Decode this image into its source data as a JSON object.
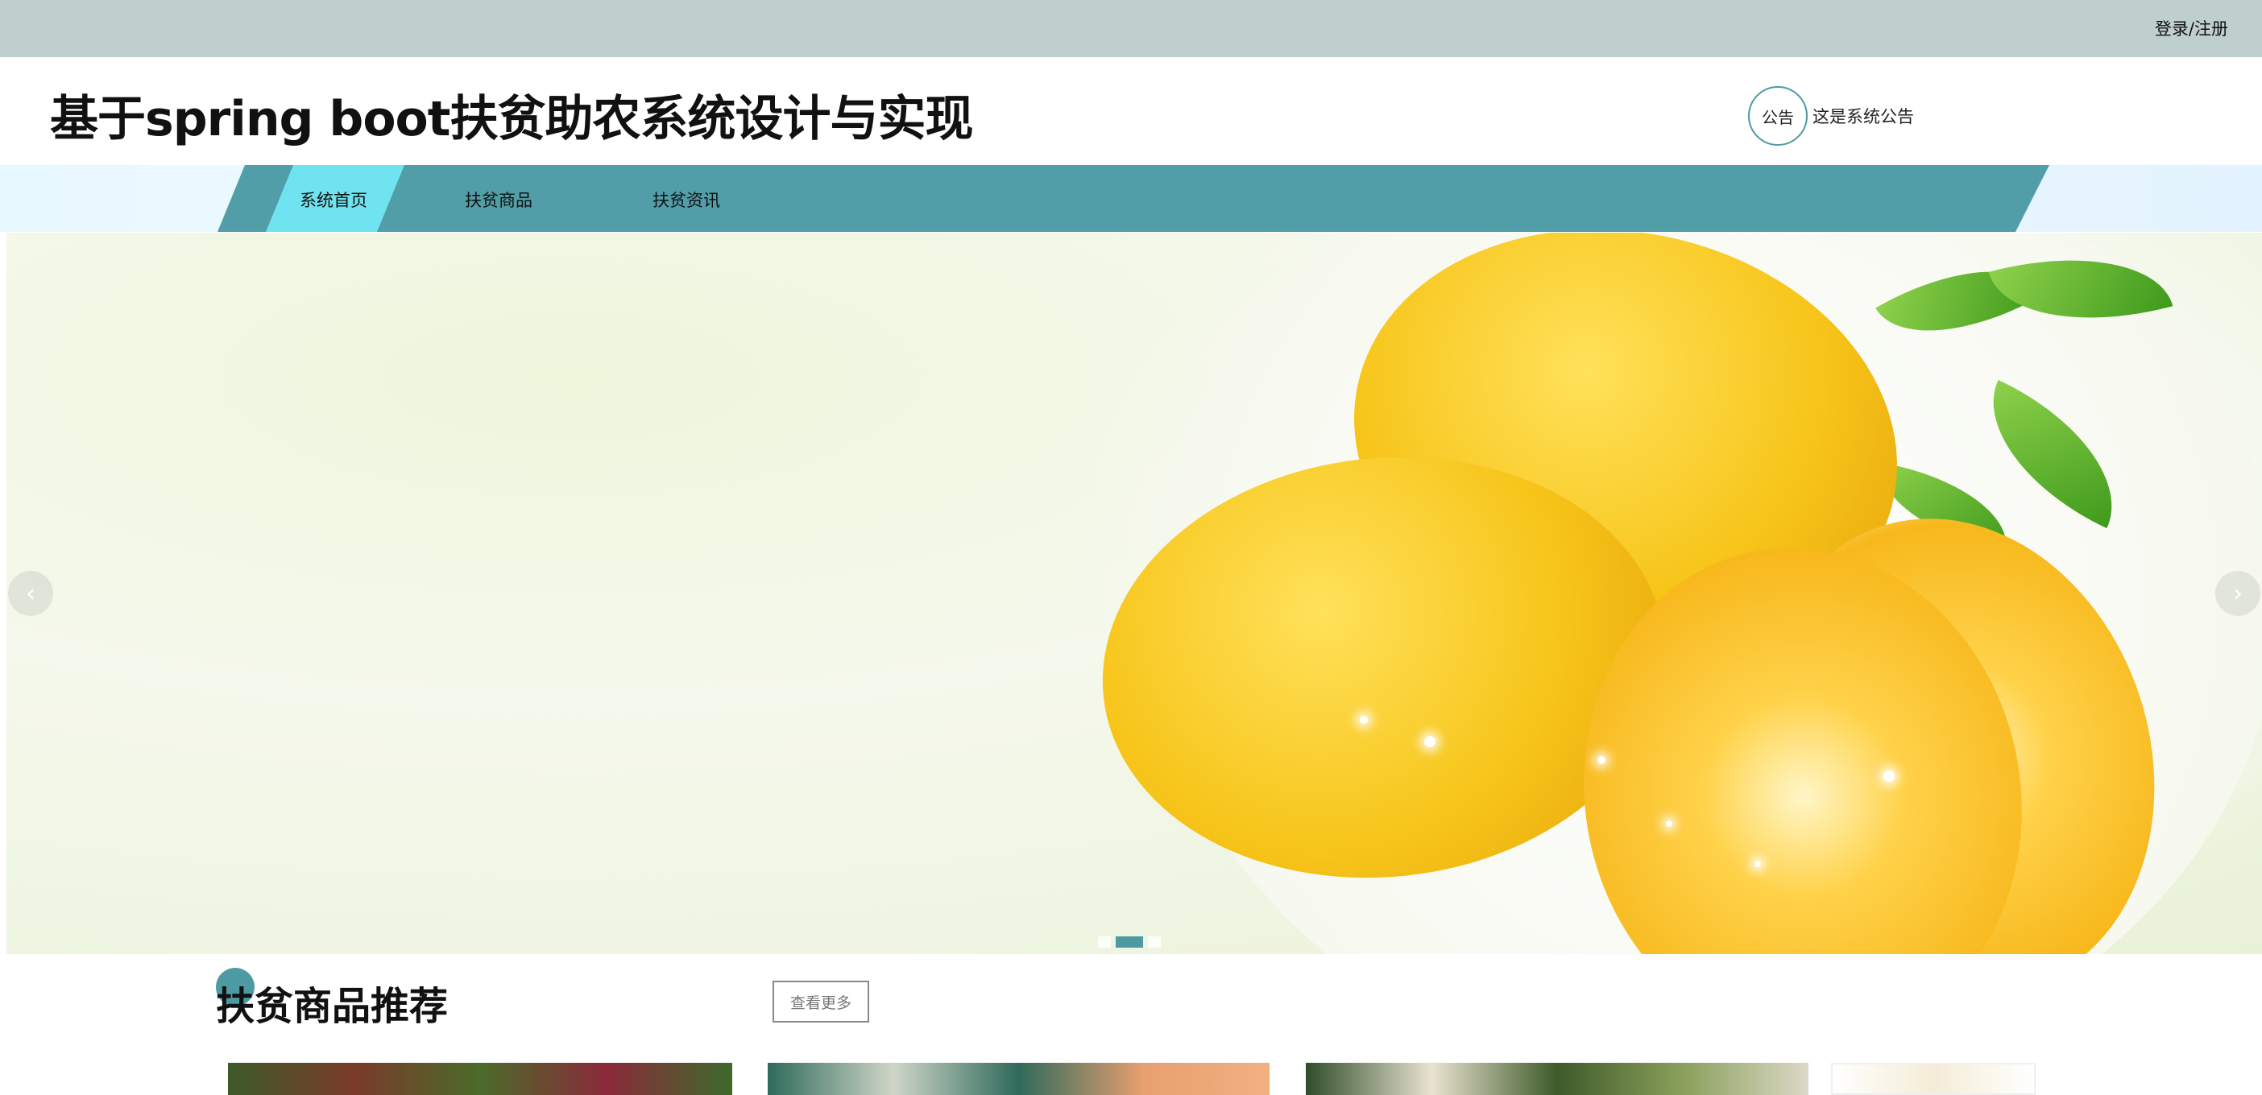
{
  "topbar": {
    "login_label": "登录/注册"
  },
  "header": {
    "title": "基于spring boot扶贫助农系统设计与实现",
    "notice_badge": "公告",
    "notice_text": "这是系统公告"
  },
  "nav": {
    "items": [
      {
        "label": "系统首页",
        "active": true
      },
      {
        "label": "扶贫商品",
        "active": false
      },
      {
        "label": "扶贫资讯",
        "active": false
      }
    ]
  },
  "banner": {
    "prev_icon": "chevron-left-icon",
    "prev_glyph": "‹",
    "next_icon": "chevron-right-icon",
    "next_glyph": "›",
    "slide_count": 3,
    "active_slide": 2
  },
  "section": {
    "title": "扶贫商品推荐",
    "more_label": "查看更多"
  },
  "colors": {
    "topbar": "#bfcfcd",
    "nav_band": "#519ea8",
    "nav_active": "#6fe3ef",
    "accent": "#4e9aa3"
  }
}
